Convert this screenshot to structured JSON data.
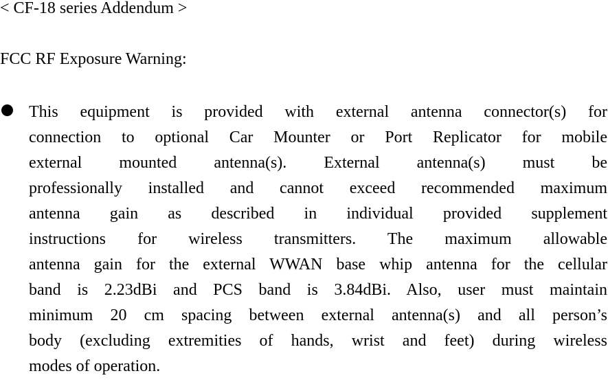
{
  "document": {
    "title": "< CF-18 series Addendum >",
    "section_heading": "FCC RF Exposure Warning:",
    "bullet_icon": "filled-circle-bullet",
    "bullet_paragraph": {
      "lines": [
        "This equipment is provided with external antenna connector(s) for",
        "connection to optional Car Mounter or Port Replicator for mobile",
        "external mounted antenna(s).  External antenna(s) must be",
        "professionally installed and cannot exceed recommended maximum",
        "antenna gain as described in individual provided supplement",
        "instructions for wireless transmitters.  The maximum allowable",
        "antenna gain for the external WWAN base whip antenna for the cellular",
        "band is 2.23dBi and PCS band is 3.84dBi.   Also, user must maintain",
        "minimum 20 cm spacing between external antenna(s) and all person’s",
        "body (excluding extremities of hands, wrist and feet) during wireless",
        "modes of operation."
      ]
    }
  }
}
